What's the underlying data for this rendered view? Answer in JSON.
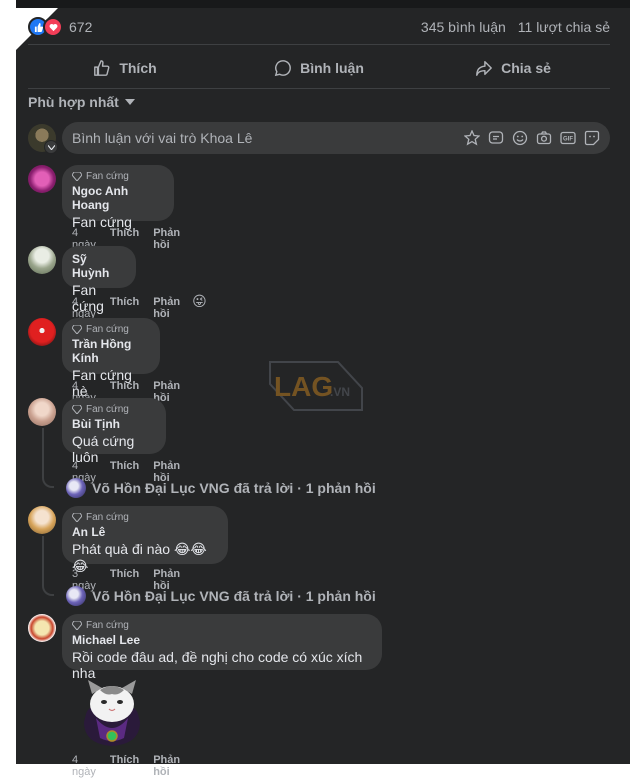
{
  "post_stats": {
    "reaction_count": "672",
    "comments": "345 bình luận",
    "shares": "11 lượt chia sẻ"
  },
  "actions": {
    "like": "Thích",
    "comment": "Bình luận",
    "share": "Chia sẻ"
  },
  "sort": {
    "label": "Phù hợp nhất"
  },
  "composer": {
    "placeholder": "Bình luận với vai trò Khoa Lê"
  },
  "watermark": {
    "brand": "LAG",
    "suffix": ".VN"
  },
  "comments": [
    {
      "badge": "Fan cứng",
      "name": "Ngoc Anh Hoang",
      "text": "Fan cứng",
      "time": "4 ngày",
      "like": "Thích",
      "reply": "Phản hồi"
    },
    {
      "badge": "",
      "name": "Sỹ Huỳnh",
      "text": "Fan cứng",
      "time": "4 ngày",
      "like": "Thích",
      "reply": "Phản hồi",
      "reaction": "😜"
    },
    {
      "badge": "Fan cứng",
      "name": "Trần Hồng Kính",
      "text": "Fan cứng nè",
      "time": "4 ngày",
      "like": "Thích",
      "reply": "Phản hồi"
    },
    {
      "badge": "Fan cứng",
      "name": "Bùi Tịnh",
      "text": "Quá cứng luôn",
      "time": "4 ngày",
      "like": "Thích",
      "reply": "Phản hồi",
      "reply_summary": "Võ Hồn Đại Lục VNG đã trả lời · 1 phản hồi"
    },
    {
      "badge": "Fan cứng",
      "name": "An Lê",
      "text": "Phát quà đi nào 😂😂😂",
      "time": "3 ngày",
      "like": "Thích",
      "reply": "Phản hồi",
      "reply_summary": "Võ Hồn Đại Lục VNG đã trả lời · 1 phản hồi"
    },
    {
      "badge": "Fan cứng",
      "name": "Michael Lee",
      "text": "Rồi code đâu ad, đề nghị cho code có xúc xích nha",
      "time": "4 ngày",
      "like": "Thích",
      "reply": "Phản hồi"
    }
  ]
}
